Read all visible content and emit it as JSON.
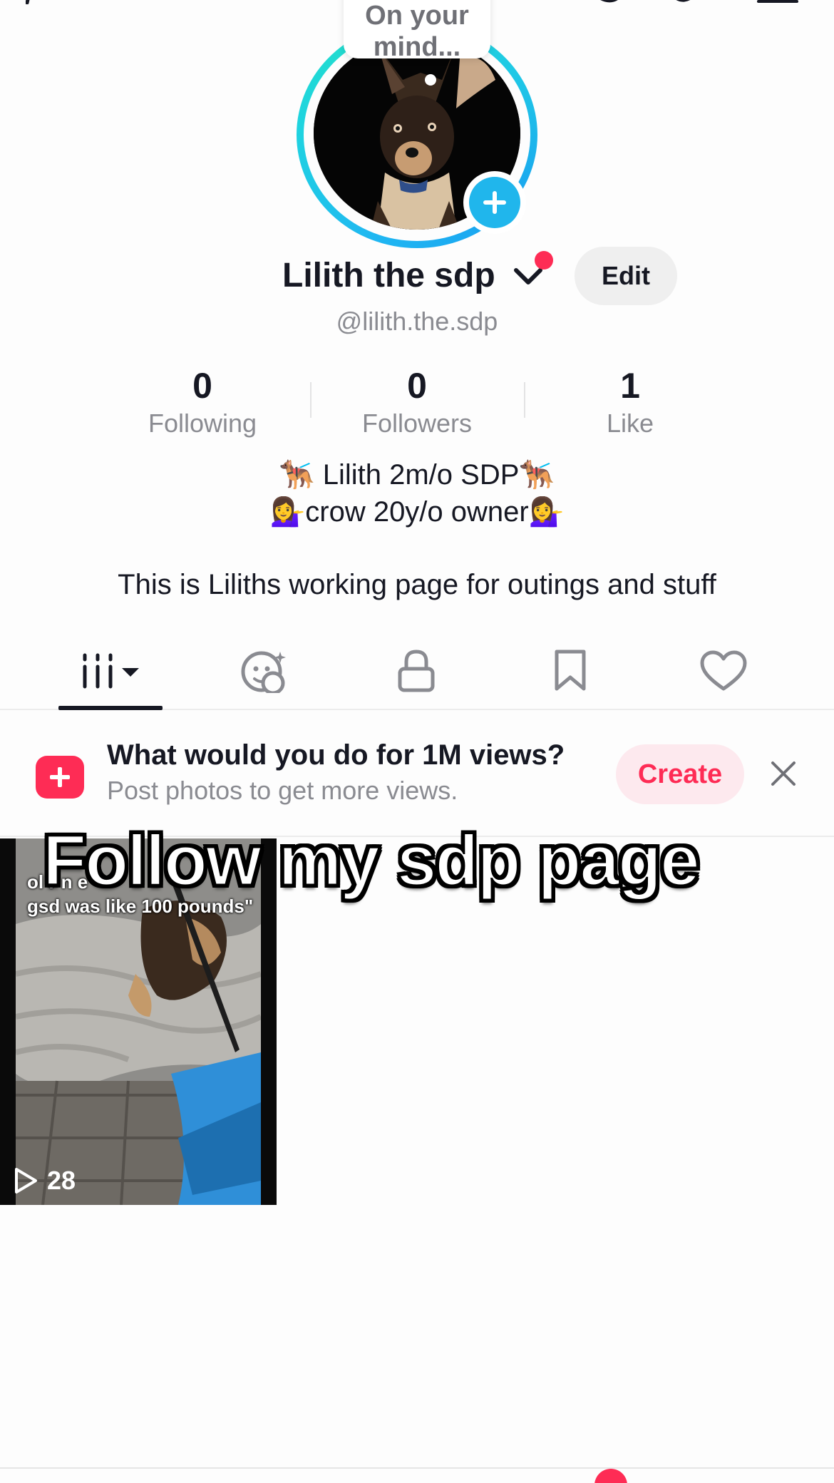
{
  "profile": {
    "bubble_text": "On your mind...",
    "display_name": "Lilith the sdp",
    "edit_label": "Edit",
    "handle": "@lilith.the.sdp"
  },
  "stats": [
    {
      "value": "0",
      "label": "Following"
    },
    {
      "value": "0",
      "label": "Followers"
    },
    {
      "value": "1",
      "label": "Like"
    }
  ],
  "bio": {
    "line1_text": " Lilith 2m/o SDP",
    "line2_text": "crow 20y/o owner",
    "dog_emoji": "🐕‍🦺",
    "person_emoji": "💁‍♀️",
    "description": "This is Liliths working page for outings and stuff"
  },
  "tabs": [
    {
      "icon": "grid-videos-icon",
      "active": true
    },
    {
      "icon": "reposts-icon"
    },
    {
      "icon": "lock-icon"
    },
    {
      "icon": "bookmark-icon"
    },
    {
      "icon": "heart-icon"
    }
  ],
  "promo": {
    "title": "What would you do for 1M views?",
    "subtitle": "Post photos to get more views.",
    "create_label": "Create"
  },
  "video": {
    "caption_line1": "ol  r n             e",
    "caption_line2": "gsd was like 100 pounds\"",
    "play_count": "28",
    "overlay_title": "Follow my sdp page"
  },
  "colors": {
    "accent_red": "#fe2c55",
    "ring_blue": "#20b6ec",
    "ring_teal": "#22e0c8",
    "text_primary": "#161823",
    "text_secondary": "#8a8b91"
  }
}
